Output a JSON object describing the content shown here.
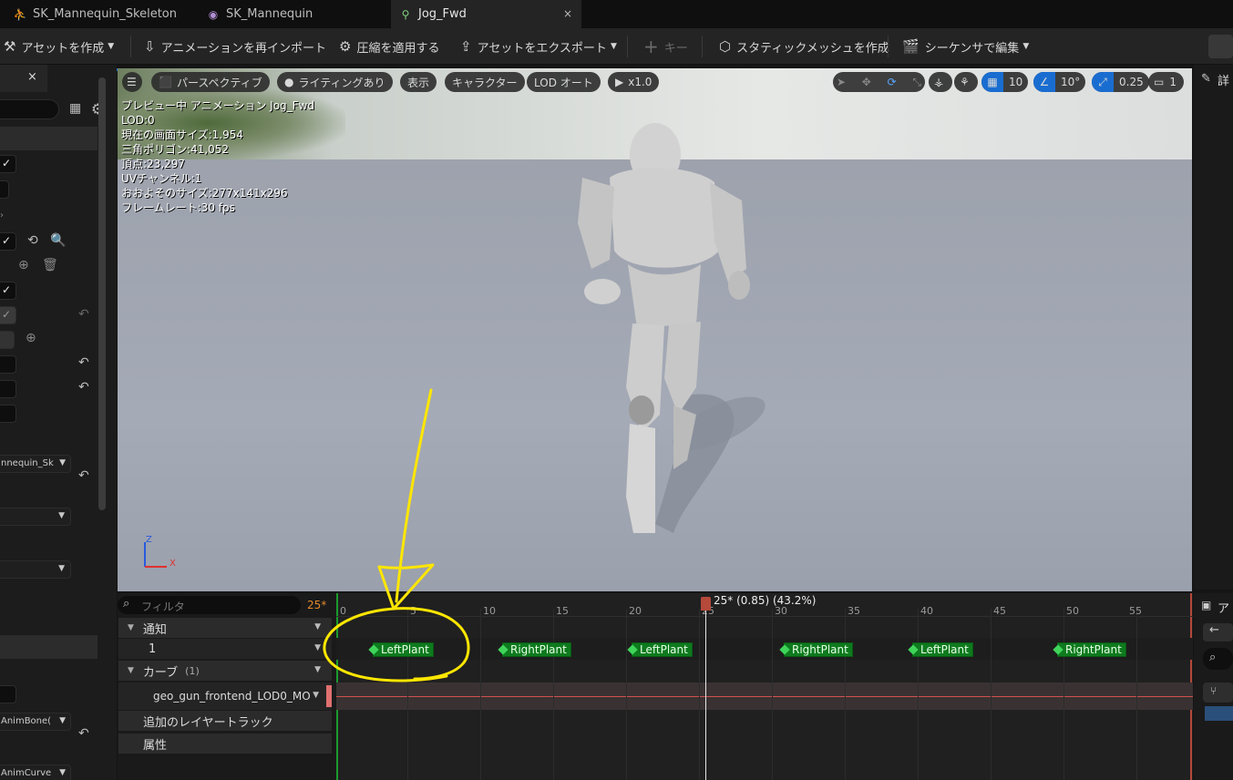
{
  "tabs": [
    {
      "label": "SK_Mannequin_Skeleton",
      "icon": "skeleton-icon"
    },
    {
      "label": "SK_Mannequin",
      "icon": "skeletal-mesh-icon"
    },
    {
      "label": "Jog_Fwd",
      "icon": "animation-icon",
      "close": "×"
    }
  ],
  "toolbar": {
    "create_asset": "アセットを作成",
    "reimport": "アニメーションを再インポート",
    "apply_compression": "圧縮を適用する",
    "export_asset": "アセットをエクスポート",
    "key": "キー",
    "make_static_mesh": "スタティックメッシュを作成",
    "edit_in_sequencer": "シーケンサで編集"
  },
  "left_panel": {
    "close": "×",
    "skeleton_value": "nnequin_Sk",
    "anim_bone": "AnimBone(",
    "anim_curve": "AnimCurve"
  },
  "viewport": {
    "buttons": {
      "perspective": "パースペクティブ",
      "lighting": "ライティングあり",
      "show": "表示",
      "character": "キャラクター",
      "lod": "LOD オート",
      "speed": "x1.0",
      "grid": "10",
      "angle": "10°",
      "scale": "0.25",
      "camera": "1"
    },
    "stats": [
      "プレビュー中 アニメーション Jog_Fwd",
      "LOD:0",
      "現在の画面サイズ:1.954",
      "三角ポリゴン:41,052",
      "頂点:23,297",
      "UVチャンネル:1",
      "おおよそのサイズ:277x141x296",
      "フレームレート:30 fps"
    ],
    "axis_z": "Z",
    "axis_x": "X"
  },
  "right_strip": {
    "details_label": "詳",
    "asset_label": "ア"
  },
  "timeline": {
    "filter_placeholder": "フィルタ",
    "frame": "25*",
    "playhead": "25* (0.85) (43.2%)",
    "ticks": [
      "0",
      "5",
      "10",
      "15",
      "20",
      "25",
      "30",
      "35",
      "40",
      "45",
      "50",
      "55"
    ],
    "tracks": {
      "notifies": "通知",
      "notify_track": "1",
      "curves": "カーブ",
      "curves_count": "(1)",
      "curve_name": "geo_gun_frontend_LOD0_MO",
      "add_layer": "追加のレイヤートラック",
      "attributes": "属性"
    },
    "notifies": [
      "LeftPlant",
      "RightPlant",
      "LeftPlant",
      "RightPlant",
      "LeftPlant",
      "RightPlant"
    ]
  },
  "colors": {
    "accent_blue": "#1a6dd0",
    "notify_green": "#0e7a1e",
    "annotation_yellow": "#ffe600",
    "playhead": "#b5493a"
  }
}
